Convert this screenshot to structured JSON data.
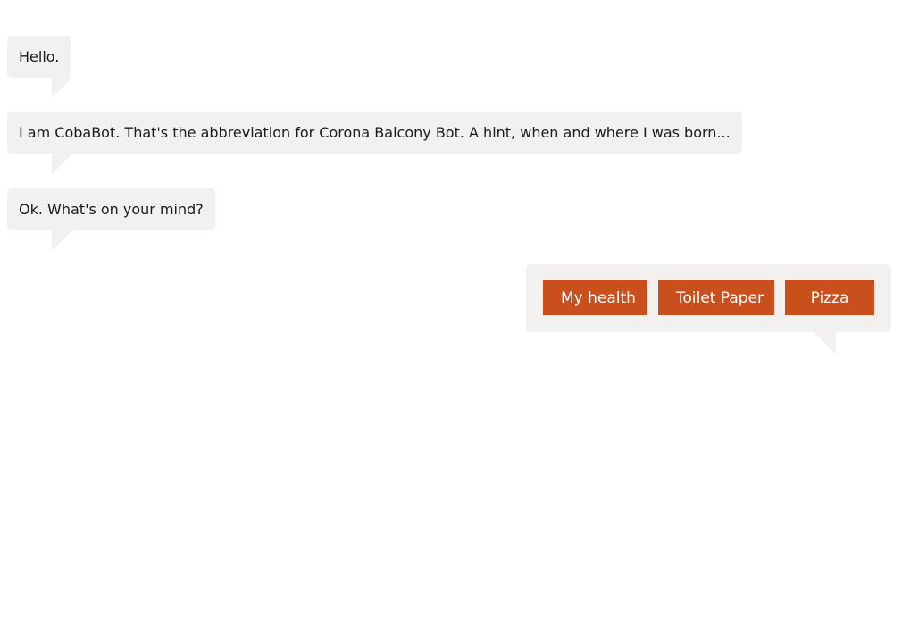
{
  "messages": [
    {
      "text": "Hello."
    },
    {
      "text": "I am CobaBot. That's the abbreviation for Corona Balcony Bot. A hint, when and where I was born..."
    },
    {
      "text": "Ok. What's on your mind?"
    }
  ],
  "suggested_actions": [
    {
      "label": "My health"
    },
    {
      "label": "Toilet Paper"
    },
    {
      "label": "Pizza"
    }
  ],
  "colors": {
    "bubble_bg": "#f2f1f0",
    "action_button": "#c9501c",
    "action_text": "#ffffff"
  }
}
